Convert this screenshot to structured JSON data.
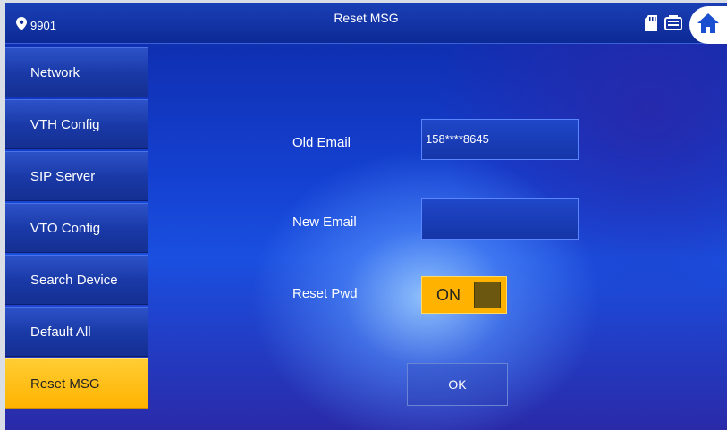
{
  "header": {
    "room_number": "9901",
    "title": "Reset MSG",
    "icons": [
      "location-pin-icon",
      "sd-card-icon",
      "monitor-icon",
      "home-icon"
    ]
  },
  "sidebar": {
    "items": [
      {
        "label": "Network"
      },
      {
        "label": "VTH Config"
      },
      {
        "label": "SIP Server"
      },
      {
        "label": "VTO Config"
      },
      {
        "label": "Search Device"
      },
      {
        "label": "Default All"
      },
      {
        "label": "Reset MSG",
        "active": true
      }
    ]
  },
  "form": {
    "old_email_label": "Old Email",
    "old_email_value": "158****8645",
    "new_email_label": "New Email",
    "new_email_value": "",
    "reset_pwd_label": "Reset Pwd",
    "reset_pwd_state": "ON",
    "ok_label": "OK"
  },
  "colors": {
    "accent": "#ffb300",
    "background": "#1440d0",
    "header": "#0c2a95"
  }
}
